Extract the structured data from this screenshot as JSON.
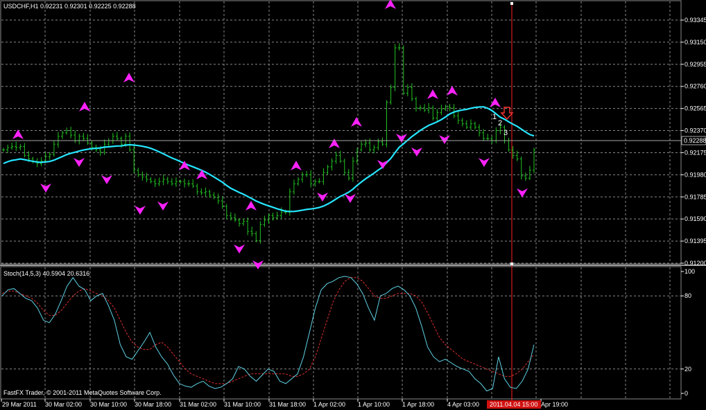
{
  "main_header": "USDCHF,H1  0.92231 0.92301 0.92225 0.92288",
  "stoch_header": "Stoch(14,5,3) 40.5904 20.6316",
  "copyright": "FastFX Trader, © 2001-2011 MetaQuotes Software Corp.",
  "current_price_tag": "0.92288",
  "cursor_time_tag": "2011.04.04 15:00",
  "signal_numbers": [
    "1",
    "2",
    "3"
  ],
  "colors": {
    "background": "#000000",
    "grid": "#8a8a8a",
    "bars": "#22c322",
    "moving_average": "#26e6ff",
    "arrows": "#ff22ff",
    "stoch_main": "#5fd2e6",
    "stoch_signal": "#e03030",
    "vertical_line": "#ff2020",
    "signal_arrow": "#ff3333"
  },
  "chart_data": [
    {
      "type": "ohlc",
      "symbol": "USDCHF",
      "timeframe": "H1",
      "price_axis_labels": [
        "0.93345",
        "0.93150",
        "0.92955",
        "0.92760",
        "0.92565",
        "0.92370",
        "0.92175",
        "0.91980",
        "0.91785",
        "0.91590",
        "0.91395",
        "0.91200"
      ],
      "time_axis_labels": [
        "29 Mar 2011",
        "30 Mar 02:00",
        "30 Mar 10:00",
        "30 Mar 18:00",
        "31 Mar 02:00",
        "31 Mar 10:00",
        "31 Mar 18:00",
        "1 Apr 02:00",
        "1 Apr 10:00",
        "1 Apr 18:00",
        "4 Apr 03:00",
        "Apr 19:00"
      ],
      "ylim": [
        0.9118,
        0.9353
      ],
      "last_close": 0.92288,
      "approx_closes": [
        0.922,
        0.9222,
        0.9223,
        0.9222,
        0.9223,
        0.9215,
        0.9212,
        0.921,
        0.9208,
        0.921,
        0.9214,
        0.9216,
        0.9225,
        0.9232,
        0.9235,
        0.9237,
        0.9233,
        0.9228,
        0.9232,
        0.923,
        0.9226,
        0.9222,
        0.922,
        0.9218,
        0.9225,
        0.9228,
        0.9232,
        0.923,
        0.9225,
        0.9232,
        0.922,
        0.9202,
        0.9198,
        0.9196,
        0.9194,
        0.9192,
        0.919,
        0.9192,
        0.9194,
        0.9192,
        0.919,
        0.9192,
        0.9192,
        0.919,
        0.919,
        0.9188,
        0.9183,
        0.9182,
        0.9183,
        0.918,
        0.9178,
        0.9175,
        0.917,
        0.9162,
        0.916,
        0.9158,
        0.9155,
        0.9157,
        0.9148,
        0.9146,
        0.914,
        0.9154,
        0.9158,
        0.9162,
        0.916,
        0.9162,
        0.9165,
        0.9165,
        0.9183,
        0.919,
        0.9194,
        0.9198,
        0.9198,
        0.919,
        0.9192,
        0.9192,
        0.92,
        0.9205,
        0.921,
        0.9215,
        0.921,
        0.92,
        0.9195,
        0.921,
        0.922,
        0.9225,
        0.9226,
        0.922,
        0.9222,
        0.9227,
        0.9225,
        0.9262,
        0.9275,
        0.931,
        0.931,
        0.927,
        0.9275,
        0.9265,
        0.9257,
        0.9257,
        0.9255,
        0.9257,
        0.9248,
        0.9253,
        0.9256,
        0.9258,
        0.9257,
        0.925,
        0.9246,
        0.9243,
        0.924,
        0.9243,
        0.924,
        0.9235,
        0.923,
        0.923,
        0.9228,
        0.9237,
        0.924,
        0.9228,
        0.922,
        0.9215,
        0.9212,
        0.9197,
        0.9195,
        0.9202,
        0.922
      ]
    },
    {
      "type": "line",
      "indicator": "Moving Average",
      "note": "smooth line drawn over price bars (computed from closes)"
    },
    {
      "type": "line",
      "indicator": "Stochastic",
      "title": "Stoch(14,5,3) 40.5904 20.6316",
      "ylim": [
        0,
        100
      ],
      "levels": [
        20,
        80
      ],
      "y_axis_labels": [
        "100",
        "80",
        "20",
        "0"
      ],
      "series": [
        {
          "name": "main",
          "values": [
            80,
            85,
            86,
            82,
            78,
            76,
            70,
            60,
            58,
            65,
            76,
            88,
            95,
            88,
            85,
            76,
            80,
            82,
            72,
            60,
            40,
            30,
            28,
            35,
            42,
            50,
            38,
            30,
            24,
            15,
            8,
            6,
            5,
            8,
            10,
            6,
            4,
            5,
            8,
            12,
            22,
            20,
            14,
            10,
            15,
            20,
            18,
            10,
            8,
            12,
            16,
            30,
            50,
            70,
            85,
            90,
            92,
            95,
            96,
            95,
            90,
            82,
            70,
            60,
            80,
            82,
            86,
            88,
            85,
            80,
            70,
            55,
            38,
            30,
            26,
            28,
            25,
            22,
            20,
            18,
            12,
            8,
            2,
            4,
            30,
            12,
            5,
            4,
            10,
            20,
            40
          ]
        },
        {
          "name": "signal",
          "values": [
            82,
            84,
            84,
            82,
            80,
            78,
            74,
            68,
            64,
            64,
            68,
            74,
            80,
            84,
            86,
            84,
            82,
            80,
            76,
            70,
            60,
            50,
            42,
            38,
            36,
            36,
            40,
            42,
            38,
            32,
            26,
            20,
            16,
            14,
            12,
            10,
            8,
            8,
            8,
            10,
            12,
            14,
            16,
            16,
            16,
            16,
            16,
            16,
            16,
            14,
            14,
            16,
            20,
            30,
            45,
            60,
            75,
            85,
            92,
            95,
            95,
            92,
            86,
            80,
            78,
            78,
            80,
            82,
            82,
            82,
            80,
            75,
            66,
            56,
            46,
            40,
            36,
            32,
            28,
            26,
            24,
            22,
            20,
            18,
            16,
            14,
            14,
            16,
            20,
            26,
            32
          ]
        }
      ]
    }
  ]
}
